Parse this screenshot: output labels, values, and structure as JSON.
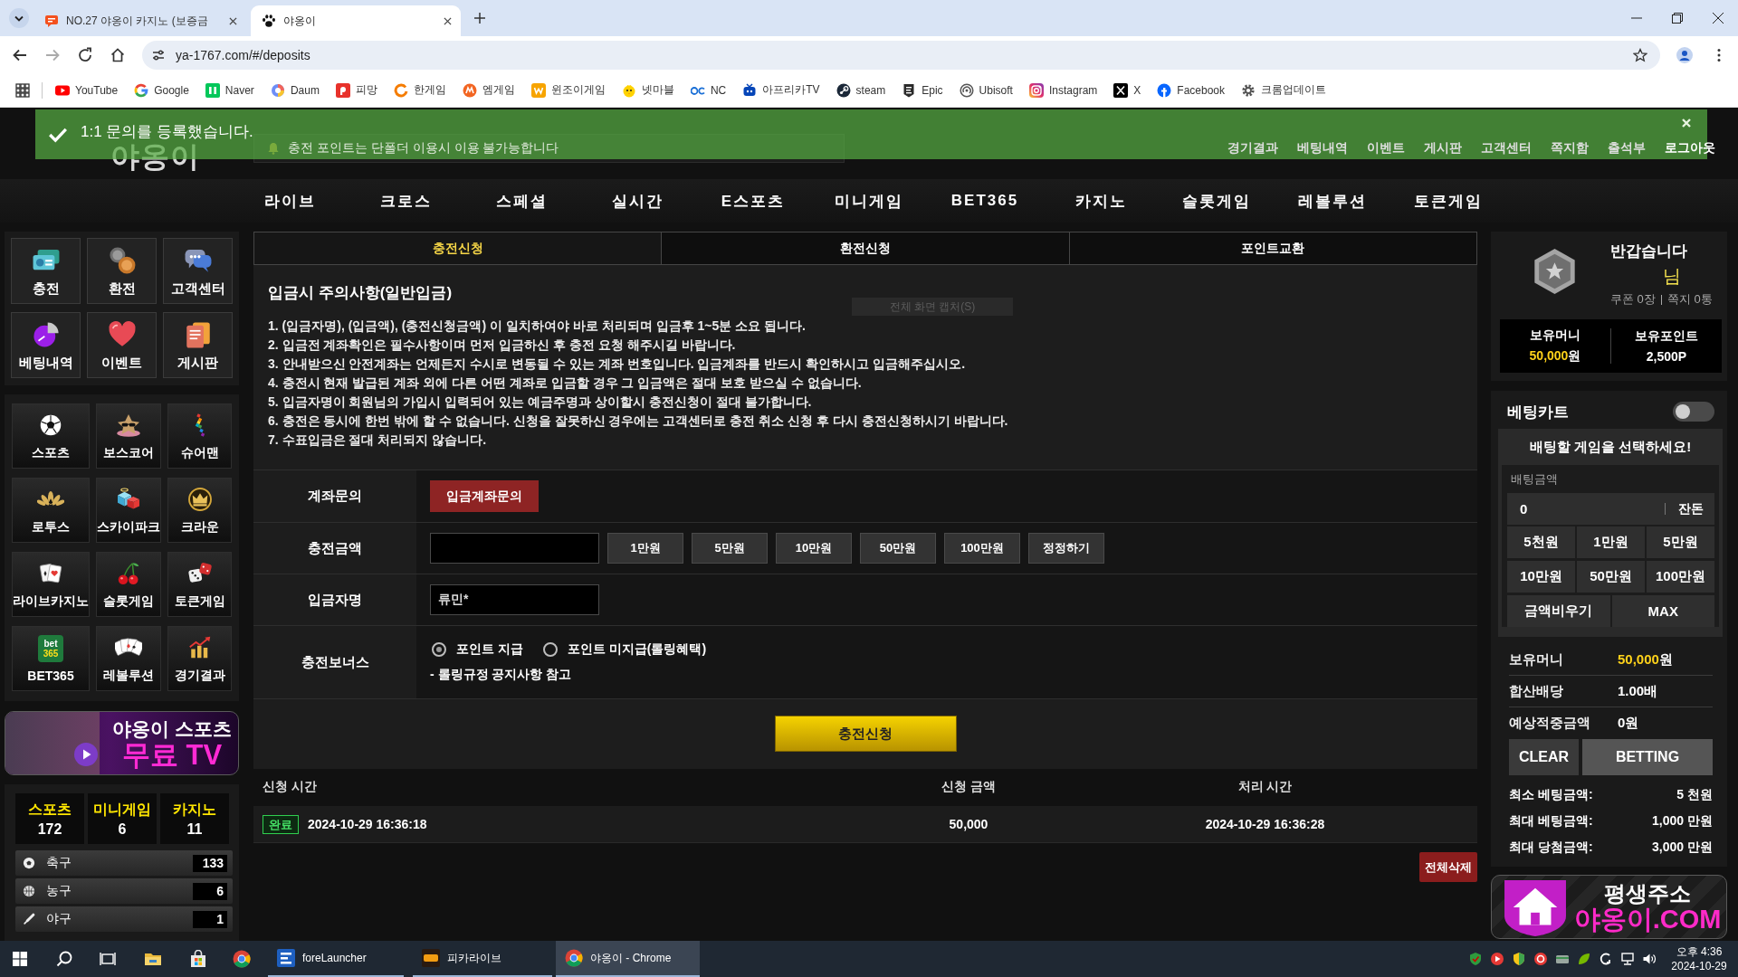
{
  "browser": {
    "tabs": [
      {
        "title": "NO.27 야옹이 카지노 (보증금",
        "selected": false
      },
      {
        "title": "야옹이",
        "selected": true
      }
    ],
    "address": "ya-1767.com/#/deposits",
    "bookmarks": [
      "YouTube",
      "Google",
      "Naver",
      "Daum",
      "피망",
      "한게임",
      "엠게임",
      "윈조이게임",
      "넷마블",
      "NC",
      "아프리카TV",
      "steam",
      "Epic",
      "Ubisoft",
      "Instagram",
      "X",
      "Facebook",
      "크롬업데이트"
    ]
  },
  "toast": {
    "message": "1:1 문의를 등록했습니다."
  },
  "header": {
    "logo": "야옹이",
    "notice": "충전 포인트는 단폴더 이용시 이용 불가능합니다",
    "links": [
      {
        "label": "경기결과",
        "kind": "link"
      },
      {
        "label": "베팅내역",
        "kind": "link"
      },
      {
        "label": "이벤트",
        "kind": "link"
      },
      {
        "label": "게시판",
        "kind": "link"
      },
      {
        "label": "고객센터",
        "kind": "link"
      },
      {
        "label": "쪽지함",
        "kind": "link"
      },
      {
        "label": "출석부",
        "kind": "link"
      },
      {
        "label": "로그아웃",
        "kind": "account"
      }
    ]
  },
  "nav": [
    "라이브",
    "크로스",
    "스페셜",
    "실시간",
    "E스포츠",
    "미니게임",
    "BET365",
    "카지노",
    "슬롯게임",
    "레볼루션",
    "토큰게임"
  ],
  "sidebar": {
    "shortcuts": [
      "충전",
      "환전",
      "고객센터",
      "베팅내역",
      "이벤트",
      "게시판"
    ],
    "games": [
      {
        "label": "스포츠"
      },
      {
        "label": "보스코어"
      },
      {
        "label": "슈어맨"
      },
      {
        "label": "로투스"
      },
      {
        "label": "스카이파크"
      },
      {
        "label": "크라운"
      },
      {
        "label": "라이브카지노"
      },
      {
        "label": "슬롯게임"
      },
      {
        "label": "토큰게임"
      },
      {
        "label": "BET365",
        "logo": [
          "bet",
          "365"
        ]
      },
      {
        "label": "레볼루션"
      },
      {
        "label": "경기결과"
      }
    ],
    "banner": {
      "title": "야옹이 스포츠",
      "subtitle": "무료 TV"
    },
    "counts": [
      {
        "label": "스포츠",
        "value": "172"
      },
      {
        "label": "미니게임",
        "value": "6"
      },
      {
        "label": "카지노",
        "value": "11"
      }
    ],
    "sports": [
      {
        "name": "축구",
        "count": "133"
      },
      {
        "name": "농구",
        "count": "6"
      },
      {
        "name": "야구",
        "count": "1"
      }
    ]
  },
  "main": {
    "tabs": [
      {
        "label": "충전신청",
        "selected": true
      },
      {
        "label": "환전신청",
        "selected": false
      },
      {
        "label": "포인트교환",
        "selected": false
      }
    ],
    "notice": {
      "title": "입금시 주의사항(일반입금)",
      "lines": [
        "1. (입금자명), (입금액), (충전신청금액) 이 일치하여야 바로 처리되며 입금후 1~5분 소요 됩니다.",
        "2. 입금전 계좌확인은 필수사항이며 먼저 입금하신 후 충전 요청 해주시길 바랍니다.",
        "3. 안내받으신 안전계좌는 언제든지 수시로 변동될 수 있는 계좌 번호입니다. 입금계좌를 반드시 확인하시고 입금해주십시오.",
        "4. 충전시 현재 발급된 계좌 외에 다른 어떤 계좌로 입금할 경우 그 입금액은 절대 보호 받으실 수 없습니다.",
        "5. 입금자명이 회원님의 가입시 입력되어 있는 예금주명과 상이할시 충전신청이 절대 불가합니다.",
        "6. 충전은 동시에 한번 밖에 할 수 없습니다. 신청을 잘못하신 경우에는 고객센터로 충전 취소 신청 후 다시 충전신청하시기 바랍니다.",
        "7. 수표입금은 절대 처리되지 않습니다."
      ]
    },
    "capture_tooltip": "전체 화면 캡처(S)",
    "form": [
      {
        "kind": "button",
        "label": "계좌문의",
        "button": "입금계좌문의"
      },
      {
        "kind": "amount",
        "label": "충전금액",
        "buttons": [
          "1만원",
          "5만원",
          "10만원",
          "50만원",
          "100만원",
          "정정하기"
        ]
      },
      {
        "kind": "text",
        "label": "입금자명",
        "value": "류민*"
      },
      {
        "kind": "radio",
        "label": "충전보너스",
        "options": [
          {
            "label": "포인트 지급",
            "selected": true
          },
          {
            "label": "포인트 미지급(롤링혜택)",
            "selected": false
          }
        ],
        "note": "- 롤링규정 공지사항 참고"
      }
    ],
    "submit": "충전신청",
    "history": {
      "columns": [
        "신청 시간",
        "신청 금액",
        "처리 시간"
      ],
      "rows": [
        {
          "status": "완료",
          "requested_at": "2024-10-29 16:36:18",
          "amount": "50,000",
          "processed_at": "2024-10-29 16:36:28"
        }
      ]
    },
    "delete_all": "전체삭제"
  },
  "account": {
    "greeting": "반갑습니다",
    "suffix": "님",
    "coupons": "쿠폰 0장",
    "messages": "쪽지 0통",
    "balances": [
      {
        "label": "보유머니",
        "value": "50,000",
        "unit": "원",
        "highlight": true
      },
      {
        "label": "보유포인트",
        "value": "2,500P",
        "highlight": false
      }
    ]
  },
  "bet_cart": {
    "title": "베팅카트",
    "on": false,
    "prompt": "배팅할 게임을 선택하세요!",
    "amount_label": "배팅금액",
    "amount": "0",
    "change": "잔돈",
    "chips": [
      "5천원",
      "1만원",
      "5만원",
      "10만원",
      "50만원",
      "100만원"
    ],
    "clear_amount": "금액비우기",
    "max": "MAX",
    "summary": [
      {
        "label": "보유머니",
        "value": "50,000",
        "unit": "원",
        "highlight": true
      },
      {
        "label": "합산배당",
        "value": "1.00배",
        "highlight": false
      },
      {
        "label": "예상적중금액",
        "value": "0원",
        "highlight": false
      }
    ],
    "clear": "CLEAR",
    "bet": "BETTING",
    "limits": [
      {
        "label": "최소 베팅금액:",
        "value": "5 천원"
      },
      {
        "label": "최대 베팅금액:",
        "value": "1,000 만원"
      },
      {
        "label": "최대 당첨금액:",
        "value": "3,000 만원"
      }
    ]
  },
  "address_banner": {
    "title": "평생주소",
    "domain": "야옹이.COM"
  },
  "taskbar": {
    "apps": [
      {
        "label": "foreLauncher",
        "selected": false
      },
      {
        "label": "피카라이브",
        "selected": false
      },
      {
        "label": "야옹이 - Chrome",
        "selected": true
      }
    ],
    "time": "오후 4:36",
    "date": "2024-10-29"
  }
}
